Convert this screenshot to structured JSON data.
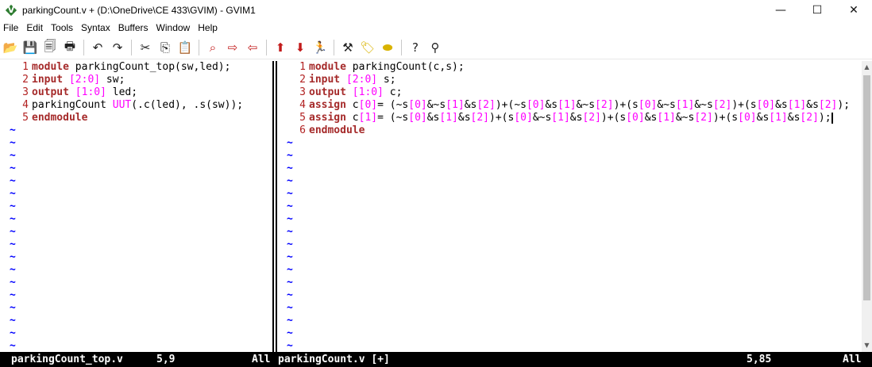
{
  "window": {
    "title": "parkingCount.v + (D:\\OneDrive\\CE 433\\GVIM) - GVIM1",
    "minimize": "—",
    "maximize": "☐",
    "close": "✕"
  },
  "menu": [
    "File",
    "Edit",
    "Tools",
    "Syntax",
    "Buffers",
    "Window",
    "Help"
  ],
  "toolbar": {
    "icons": [
      "open-icon",
      "save-icon",
      "save-all-icon",
      "print-icon",
      "undo-icon",
      "redo-icon",
      "cut-icon",
      "copy-icon",
      "paste-icon",
      "find-replace-icon",
      "find-next-icon",
      "find-prev-icon",
      "load-session-icon",
      "save-session-icon",
      "run-script-icon",
      "make-icon",
      "run-ctags-icon",
      "jump-tag-icon",
      "help-icon",
      "search-help-icon"
    ]
  },
  "left_pane": {
    "lines": [
      {
        "n": "1",
        "tokens": [
          {
            "t": "module",
            "c": "kw"
          },
          {
            "t": " parkingCount_top(sw,led);",
            "c": "txt"
          }
        ]
      },
      {
        "n": "2",
        "tokens": [
          {
            "t": "input",
            "c": "kw"
          },
          {
            "t": " ",
            "c": "txt"
          },
          {
            "t": "[2:0]",
            "c": "num"
          },
          {
            "t": " sw;",
            "c": "txt"
          }
        ]
      },
      {
        "n": "3",
        "tokens": [
          {
            "t": "output",
            "c": "kw"
          },
          {
            "t": " ",
            "c": "txt"
          },
          {
            "t": "[1:0]",
            "c": "num"
          },
          {
            "t": " led;",
            "c": "txt"
          }
        ]
      },
      {
        "n": "4",
        "tokens": [
          {
            "t": "parkingCount ",
            "c": "txt"
          },
          {
            "t": "UUT",
            "c": "num"
          },
          {
            "t": "(.c(led), .s(sw));",
            "c": "txt"
          }
        ]
      },
      {
        "n": "5",
        "tokens": [
          {
            "t": "endmodule",
            "c": "kw"
          }
        ]
      }
    ],
    "tilde": "~",
    "tilde_count": 18
  },
  "right_pane": {
    "lines": [
      {
        "n": "1",
        "tokens": [
          {
            "t": "module",
            "c": "kw"
          },
          {
            "t": " parkingCount(c,s);",
            "c": "txt"
          }
        ]
      },
      {
        "n": "2",
        "tokens": [
          {
            "t": "input",
            "c": "kw"
          },
          {
            "t": " ",
            "c": "txt"
          },
          {
            "t": "[2:0]",
            "c": "num"
          },
          {
            "t": " s;",
            "c": "txt"
          }
        ]
      },
      {
        "n": "3",
        "tokens": [
          {
            "t": "output",
            "c": "kw"
          },
          {
            "t": " ",
            "c": "txt"
          },
          {
            "t": "[1:0]",
            "c": "num"
          },
          {
            "t": " c;",
            "c": "txt"
          }
        ]
      },
      {
        "n": "4",
        "tokens": [
          {
            "t": "assign",
            "c": "kw"
          },
          {
            "t": " c",
            "c": "txt"
          },
          {
            "t": "[0]",
            "c": "num"
          },
          {
            "t": "= (~s",
            "c": "txt"
          },
          {
            "t": "[0]",
            "c": "num"
          },
          {
            "t": "&~s",
            "c": "txt"
          },
          {
            "t": "[1]",
            "c": "num"
          },
          {
            "t": "&s",
            "c": "txt"
          },
          {
            "t": "[2]",
            "c": "num"
          },
          {
            "t": ")+(~s",
            "c": "txt"
          },
          {
            "t": "[0]",
            "c": "num"
          },
          {
            "t": "&s",
            "c": "txt"
          },
          {
            "t": "[1]",
            "c": "num"
          },
          {
            "t": "&~s",
            "c": "txt"
          },
          {
            "t": "[2]",
            "c": "num"
          },
          {
            "t": ")+(s",
            "c": "txt"
          },
          {
            "t": "[0]",
            "c": "num"
          },
          {
            "t": "&~s",
            "c": "txt"
          },
          {
            "t": "[1]",
            "c": "num"
          },
          {
            "t": "&~s",
            "c": "txt"
          },
          {
            "t": "[2]",
            "c": "num"
          },
          {
            "t": ")+(s",
            "c": "txt"
          },
          {
            "t": "[0]",
            "c": "num"
          },
          {
            "t": "&s",
            "c": "txt"
          },
          {
            "t": "[1]",
            "c": "num"
          },
          {
            "t": "&s",
            "c": "txt"
          },
          {
            "t": "[2]",
            "c": "num"
          },
          {
            "t": ");",
            "c": "txt"
          }
        ]
      },
      {
        "n": "5",
        "cursor": true,
        "tokens": [
          {
            "t": "assign",
            "c": "kw"
          },
          {
            "t": " c",
            "c": "txt"
          },
          {
            "t": "[1]",
            "c": "num"
          },
          {
            "t": "= (~s",
            "c": "txt"
          },
          {
            "t": "[0]",
            "c": "num"
          },
          {
            "t": "&s",
            "c": "txt"
          },
          {
            "t": "[1]",
            "c": "num"
          },
          {
            "t": "&s",
            "c": "txt"
          },
          {
            "t": "[2]",
            "c": "num"
          },
          {
            "t": ")+(s",
            "c": "txt"
          },
          {
            "t": "[0]",
            "c": "num"
          },
          {
            "t": "&~s",
            "c": "txt"
          },
          {
            "t": "[1]",
            "c": "num"
          },
          {
            "t": "&s",
            "c": "txt"
          },
          {
            "t": "[2]",
            "c": "num"
          },
          {
            "t": ")+(s",
            "c": "txt"
          },
          {
            "t": "[0]",
            "c": "num"
          },
          {
            "t": "&s",
            "c": "txt"
          },
          {
            "t": "[1]",
            "c": "num"
          },
          {
            "t": "&~s",
            "c": "txt"
          },
          {
            "t": "[2]",
            "c": "num"
          },
          {
            "t": ")+(s",
            "c": "txt"
          },
          {
            "t": "[0]",
            "c": "num"
          },
          {
            "t": "&s",
            "c": "txt"
          },
          {
            "t": "[1]",
            "c": "num"
          },
          {
            "t": "&s",
            "c": "txt"
          },
          {
            "t": "[2]",
            "c": "num"
          },
          {
            "t": ");",
            "c": "txt"
          }
        ]
      },
      {
        "n": "6",
        "tokens": [
          {
            "t": "endmodule",
            "c": "kw"
          }
        ]
      }
    ],
    "tilde": "~",
    "tilde_count": 17
  },
  "status": {
    "left_file": "parkingCount_top.v",
    "left_pos": "5,9",
    "left_all": "All",
    "right_file": "parkingCount.v [+]",
    "right_pos": "5,85",
    "right_all": "All"
  },
  "colors": {
    "keyword": "#a52a2a",
    "number": "#ff00ff",
    "line_number": "#b22222",
    "tilde": "#0000ff"
  }
}
